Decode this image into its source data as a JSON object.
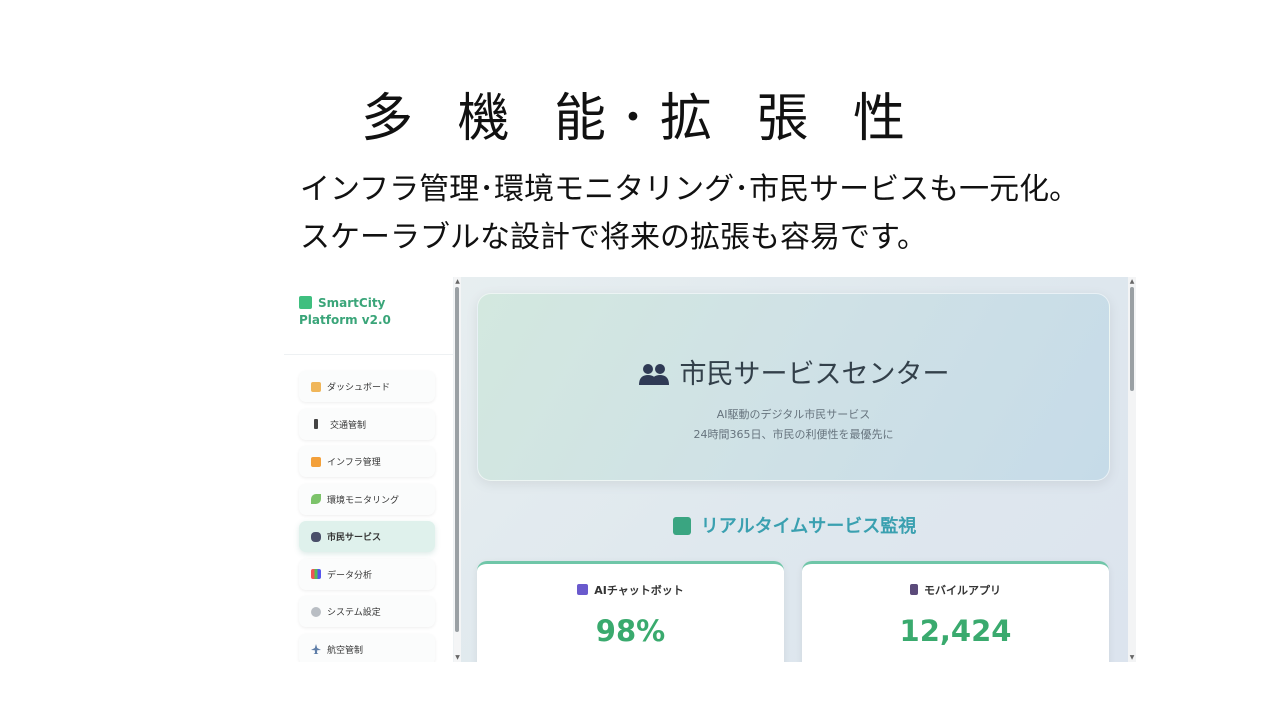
{
  "slide": {
    "title": "多 機 能･拡 張 性",
    "subtitle_line1": "インフラ管理･環境モニタリング･市民サービスも一元化。",
    "subtitle_line2": "スケーラブルな設計で将来の拡張も容易です。"
  },
  "app": {
    "brand_line1": "SmartCity",
    "brand_line2": "Platform v2.0",
    "nav": [
      {
        "label": "ダッシュボード",
        "icon": "house-icon"
      },
      {
        "label": "交通管制",
        "icon": "traffic-light-icon"
      },
      {
        "label": "インフラ管理",
        "icon": "construction-icon"
      },
      {
        "label": "環境モニタリング",
        "icon": "seedling-icon"
      },
      {
        "label": "市民サービス",
        "icon": "people-icon",
        "active": true
      },
      {
        "label": "データ分析",
        "icon": "chart-icon"
      },
      {
        "label": "システム設定",
        "icon": "gear-icon"
      },
      {
        "label": "航空管制",
        "icon": "airplane-icon"
      }
    ],
    "hero": {
      "title": "市民サービスセンター",
      "line1": "AI駆動のデジタル市民サービス",
      "line2": "24時間365日、市民の利便性を最優先に"
    },
    "section_title": "リアルタイムサービス監視",
    "cards": [
      {
        "label": "AIチャットボット",
        "value": "98%",
        "icon": "robot-icon"
      },
      {
        "label": "モバイルアプリ",
        "value": "12,424",
        "icon": "phone-icon"
      }
    ]
  }
}
